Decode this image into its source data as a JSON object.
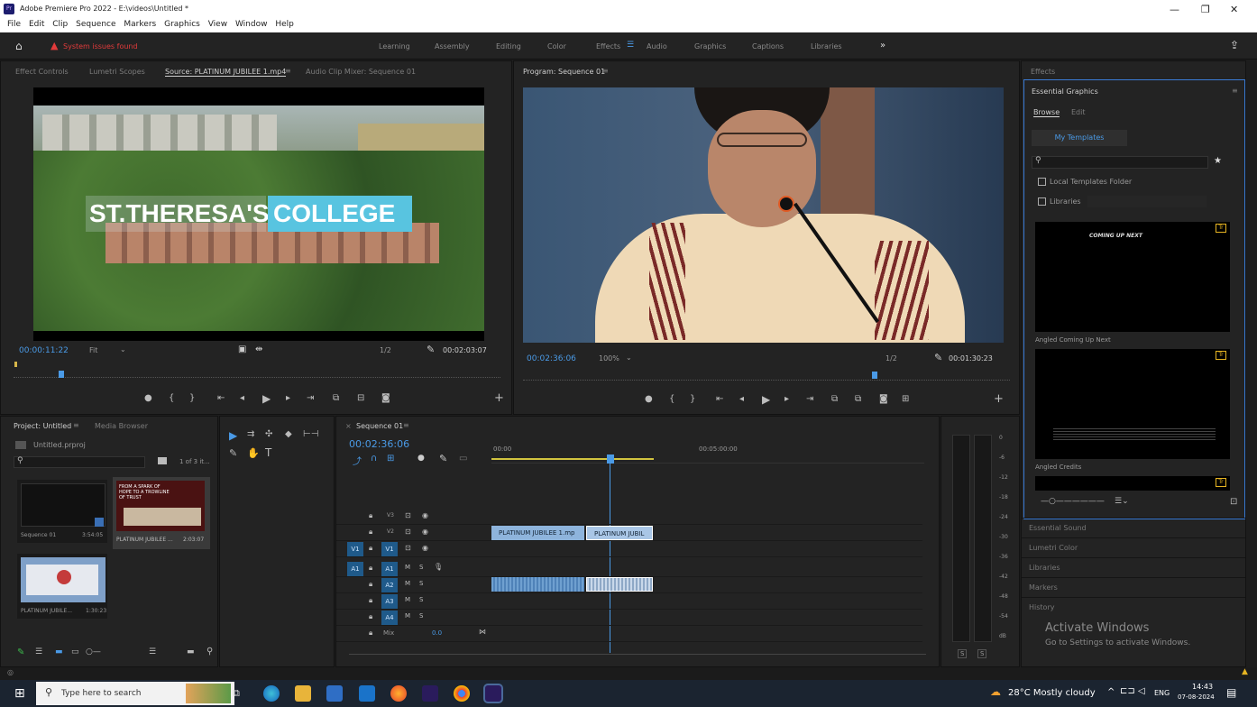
{
  "window": {
    "title": "Adobe Premiere Pro 2022 - E:\\videos\\Untitled *",
    "controls": {
      "minimize": "—",
      "maximize": "❐",
      "close": "✕"
    }
  },
  "menu": [
    "File",
    "Edit",
    "Clip",
    "Sequence",
    "Markers",
    "Graphics",
    "View",
    "Window",
    "Help"
  ],
  "header": {
    "alert": "System issues found",
    "workspaces": [
      "Learning",
      "Assembly",
      "Editing",
      "Color",
      "Effects",
      "Audio",
      "Graphics",
      "Captions",
      "Libraries"
    ],
    "active_workspace": "Effects",
    "more": "»"
  },
  "source_panel": {
    "tabs": [
      "Effect Controls",
      "Lumetri Scopes",
      "Source: PLATINUM JUBILEE 1.mp4",
      "Audio Clip Mixer: Sequence 01"
    ],
    "active_tab": "Source: PLATINUM JUBILEE 1.mp4",
    "video_title_left": "ST.THERESA'S",
    "video_title_right": "COLLEGE",
    "timecode": "00:00:11:22",
    "fit": "Fit",
    "resolution": "1/2",
    "duration": "00:02:03:07"
  },
  "program_panel": {
    "title": "Program: Sequence 01",
    "timecode": "00:02:36:06",
    "zoom": "100%",
    "resolution": "1/2",
    "duration": "00:01:30:23"
  },
  "project_panel": {
    "tabs": [
      "Project: Untitled",
      "Media Browser"
    ],
    "file": "Untitled.prproj",
    "count": "1 of 3 it...",
    "items": [
      {
        "name": "Sequence 01",
        "duration": "3:54:05"
      },
      {
        "name": "PLATINUM JUBILEE ...",
        "duration": "2:03:07"
      },
      {
        "name": "PLATINUM JUBILE...",
        "duration": "1:30:23"
      }
    ],
    "thumb_text": "FROM A SPARK OF HOPE TO A TROWLINE OF TRUST"
  },
  "timeline": {
    "tab": "Sequence 01",
    "timecode": "00:02:36:06",
    "ruler": [
      "00:00",
      "00:05:00:00"
    ],
    "video_tracks": [
      "V3",
      "V2",
      "V1"
    ],
    "audio_tracks": [
      "A1",
      "A2",
      "A3",
      "A4"
    ],
    "mix_label": "Mix",
    "mix_value": "0.0",
    "clips": [
      "PLATINUM JUBILEE 1.mp",
      "PLATINUM JUBIL"
    ]
  },
  "meter_scale": [
    "0",
    "-6",
    "-12",
    "-18",
    "-24",
    "-30",
    "-36",
    "-42",
    "-48",
    "-54",
    "dB"
  ],
  "meter_solo": [
    "S",
    "S"
  ],
  "right_panel": {
    "effects": "Effects",
    "essential_graphics": "Essential Graphics",
    "tabs": [
      "Browse",
      "Edit"
    ],
    "my_templates": "My Templates",
    "local_folder": "Local Templates Folder",
    "libraries_checkbox": "Libraries",
    "template1_preview": "COMING UP NEXT",
    "template1_name": "Angled Coming Up Next",
    "template2_name": "Angled Credits",
    "sections": [
      "Essential Sound",
      "Lumetri Color",
      "Libraries",
      "Markers",
      "History"
    ]
  },
  "activate": {
    "title": "Activate Windows",
    "subtitle": "Go to Settings to activate Windows."
  },
  "taskbar": {
    "search": "Type here to search",
    "weather": "28°C  Mostly cloudy",
    "lang": "ENG",
    "time": "14:43",
    "date": "07-08-2024"
  },
  "colors": {
    "accent": "#4a9ae6",
    "playhead": "#4a9ae6",
    "clip_video": "#8eb4dc",
    "clip_audio": "#6fa0d0",
    "alert": "#e23b3b"
  }
}
